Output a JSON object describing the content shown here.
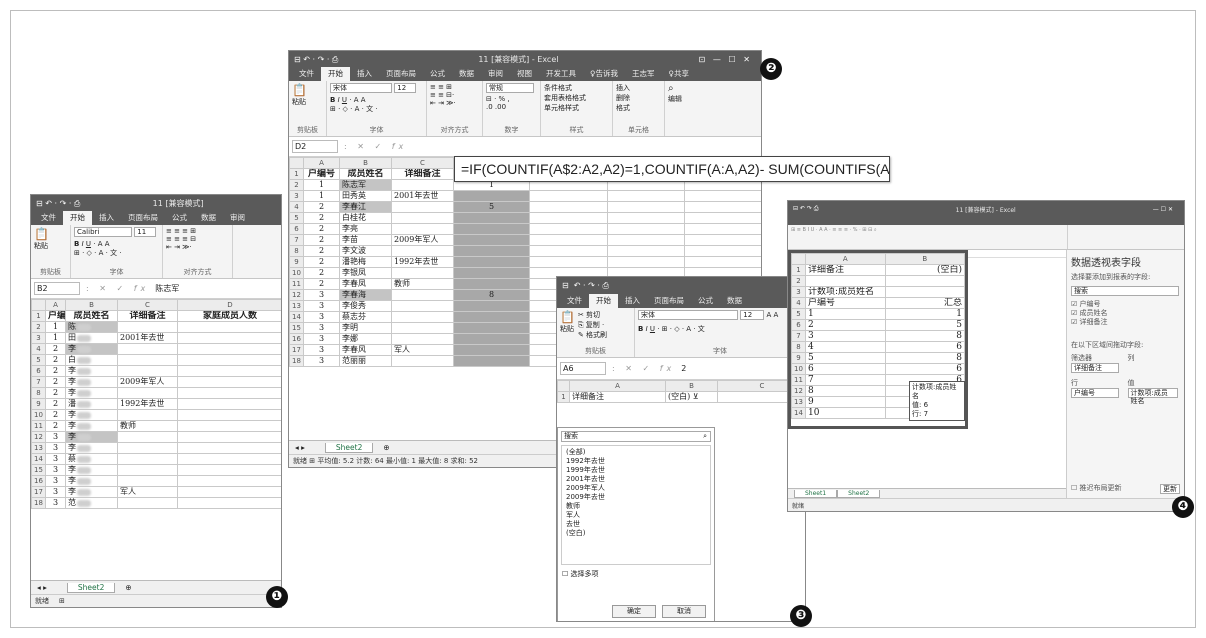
{
  "win1": {
    "qat": "⊟  ↶ ·  ↷ ·  ⎙",
    "title": "11 [兼容模式]",
    "tabs": [
      "文件",
      "开始",
      "插入",
      "页面布局",
      "公式",
      "数据",
      "审阅"
    ],
    "font": "Calibri",
    "size": "11",
    "paste": "粘贴",
    "groups": [
      "剪贴板",
      "字体",
      "对齐方式"
    ],
    "namebox": "B2",
    "fx": "fx",
    "formula": "陈志军",
    "cols": [
      "A",
      "B",
      "C",
      "D"
    ],
    "headers": [
      "户编号",
      "成员姓名",
      "详细备注",
      "家庭成员人数"
    ],
    "rows": [
      [
        "1",
        "陈",
        "",
        ""
      ],
      [
        "1",
        "田",
        "2001年去世",
        ""
      ],
      [
        "2",
        "李",
        "",
        ""
      ],
      [
        "2",
        "白",
        "",
        ""
      ],
      [
        "2",
        "李",
        "",
        ""
      ],
      [
        "2",
        "李",
        "2009年军人",
        ""
      ],
      [
        "2",
        "李",
        "",
        ""
      ],
      [
        "2",
        "潘",
        "1992年去世",
        ""
      ],
      [
        "2",
        "李",
        "",
        ""
      ],
      [
        "2",
        "李",
        "教师",
        ""
      ],
      [
        "3",
        "李",
        "",
        ""
      ],
      [
        "3",
        "李",
        "",
        ""
      ],
      [
        "3",
        "蔡",
        "",
        ""
      ],
      [
        "3",
        "李",
        "",
        ""
      ],
      [
        "3",
        "李",
        "",
        ""
      ],
      [
        "3",
        "李",
        "军人",
        ""
      ],
      [
        "3",
        "范",
        "",
        ""
      ]
    ],
    "sheet": "Sheet2",
    "status": "就绪"
  },
  "win2": {
    "qat": "⊟  ↶ ·  ↷ ·  ⎙",
    "title": "11 [兼容模式] - Excel",
    "tabs": [
      "文件",
      "开始",
      "插入",
      "页面布局",
      "公式",
      "数据",
      "审阅",
      "视图",
      "开发工具",
      "♀告诉我",
      "王志军",
      "♀共享"
    ],
    "font": "宋体",
    "size": "12",
    "numfmt": "常规",
    "groups": [
      "剪贴板",
      "字体",
      "对齐方式",
      "数字",
      "样式",
      "单元格"
    ],
    "styles": [
      "条件格式",
      "套用表格格式",
      "单元格样式"
    ],
    "cells": [
      "插入",
      "删除",
      "格式"
    ],
    "edit": "编辑",
    "namebox": "D2",
    "cols": [
      "A",
      "B",
      "C",
      "D",
      "E",
      "F",
      "G"
    ],
    "headers": [
      "户编号",
      "成员姓名",
      "详细备注",
      "家庭成员人数"
    ],
    "rows": [
      [
        "1",
        "陈志军",
        "",
        "1"
      ],
      [
        "1",
        "田秀英",
        "2001年去世",
        ""
      ],
      [
        "2",
        "李春江",
        "",
        "5"
      ],
      [
        "2",
        "白桂花",
        "",
        ""
      ],
      [
        "2",
        "李亮",
        "",
        ""
      ],
      [
        "2",
        "李苗",
        "2009年军人",
        ""
      ],
      [
        "2",
        "李文波",
        "",
        ""
      ],
      [
        "2",
        "潘艳梅",
        "1992年去世",
        ""
      ],
      [
        "2",
        "李银凤",
        "",
        ""
      ],
      [
        "2",
        "李春凤",
        "教师",
        ""
      ],
      [
        "3",
        "李春海",
        "",
        "8"
      ],
      [
        "3",
        "李俊秀",
        "",
        ""
      ],
      [
        "3",
        "蔡志芬",
        "",
        ""
      ],
      [
        "3",
        "李明",
        "",
        ""
      ],
      [
        "3",
        "李娜",
        "",
        ""
      ],
      [
        "3",
        "李春风",
        "军人",
        ""
      ],
      [
        "3",
        "范丽丽",
        "",
        ""
      ]
    ],
    "sheet": "Sheet2",
    "status": "就绪  ⊞   平均值: 5.2   计数: 64   最小值: 1   最大值: 8   求和: 52"
  },
  "formula_callout": "=IF(COUNTIF(A$2:A2,A2)=1,COUNTIF(A:A,A2)- SUM(COUNTIFS(A:A,",
  "win3": {
    "tabs": [
      "文件",
      "开始",
      "插入",
      "页面布局",
      "公式",
      "数据"
    ],
    "clip": [
      "✂ 剪切",
      "⎘ 复制 ·",
      "✎ 格式刷"
    ],
    "paste": "粘贴",
    "font": "宋体",
    "size": "12",
    "groups": [
      "剪贴板",
      "字体"
    ],
    "namebox": "A6",
    "formula": "2",
    "cols": [
      "A",
      "B",
      "C"
    ],
    "a1": "详细备注",
    "b1": "(空白)",
    "search": "搜索",
    "items": [
      "(全部)",
      "1992年去世",
      "1999年去世",
      "2001年去世",
      "2009年军人",
      "2009年去世",
      "教师",
      "军人",
      "去世",
      "(空白)"
    ],
    "multi": "选择多项",
    "ok": "确定",
    "cancel": "取消"
  },
  "win4": {
    "title": "11 [兼容模式] - Excel",
    "inset": {
      "a1": "详细备注",
      "b1": "(空白)",
      "a3": "计数项:成员姓名",
      "a4": "户编号",
      "b4": "汇总",
      "rows": [
        [
          "1",
          "1"
        ],
        [
          "2",
          "5"
        ],
        [
          "3",
          "8"
        ],
        [
          "4",
          "6"
        ],
        [
          "5",
          "8"
        ],
        [
          "6",
          "6"
        ],
        [
          "7",
          "6"
        ],
        [
          "8",
          ""
        ],
        [
          "9",
          ""
        ],
        [
          "10",
          ""
        ]
      ],
      "tip": [
        "计数项:成员姓名",
        "值: 6",
        "行: 7"
      ]
    },
    "pane": {
      "title": "数据透视表字段",
      "sub": "选择要添加到报表的字段:",
      "search": "搜索",
      "fields": [
        "☑ 户编号",
        "☑ 成员姓名",
        "☑ 详细备注"
      ],
      "areas": "在以下区域间拖动字段:",
      "filter": "筛选器",
      "filter_item": "详细备注",
      "rows": "行",
      "row_item": "户编号",
      "cols": "列",
      "vals": "值",
      "val_item": "计数项:成员姓名",
      "defer": "推迟布局更新",
      "update": "更新"
    },
    "sheets": [
      "Sheet1",
      "Sheet2"
    ],
    "status": "就绪"
  },
  "badges": [
    "❶",
    "❷",
    "❸",
    "❹"
  ]
}
